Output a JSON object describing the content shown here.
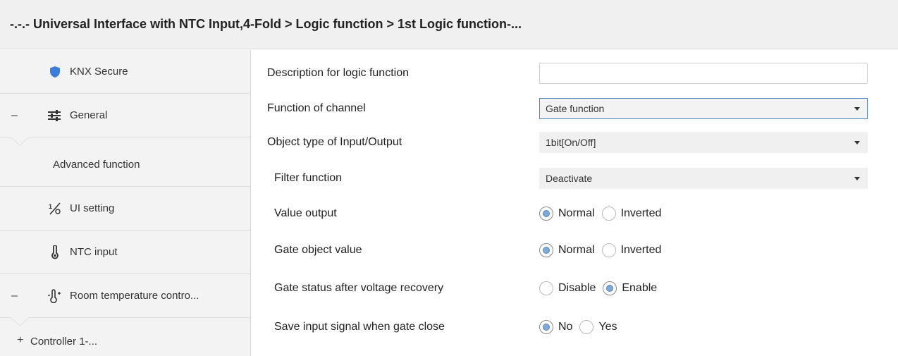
{
  "window": {
    "breadcrumb": "-.-.- Universal Interface with NTC Input,4-Fold > Logic function > 1st Logic function-..."
  },
  "sidebar": {
    "items": [
      {
        "label": "KNX Secure",
        "icon": "shield-icon",
        "toggle": ""
      },
      {
        "label": "General",
        "icon": "sliders-icon",
        "toggle": "–"
      },
      {
        "label": "Advanced function",
        "icon": "",
        "toggle": ""
      },
      {
        "label": "UI setting",
        "icon": "ui-setting-icon",
        "toggle": ""
      },
      {
        "label": "NTC input",
        "icon": "thermometer-icon",
        "toggle": ""
      },
      {
        "label": "Room temperature contro...",
        "icon": "thermometer-plus-icon",
        "toggle": "–"
      },
      {
        "label": "Controller 1-...",
        "icon": "",
        "toggle": "+"
      }
    ]
  },
  "params": {
    "description": {
      "label": "Description for logic function",
      "value": ""
    },
    "function_of_channel": {
      "label": "Function of channel",
      "value": "Gate function"
    },
    "object_type": {
      "label": "Object type of Input/Output",
      "value": "1bit[On/Off]"
    },
    "filter_function": {
      "label": "Filter function",
      "value": "Deactivate"
    },
    "value_output": {
      "label": "Value output",
      "options": [
        "Normal",
        "Inverted"
      ],
      "selected": "Normal"
    },
    "gate_object_value": {
      "label": "Gate object value",
      "options": [
        "Normal",
        "Inverted"
      ],
      "selected": "Normal"
    },
    "gate_status_recovery": {
      "label": "Gate status after voltage recovery",
      "options": [
        "Disable",
        "Enable"
      ],
      "selected": "Enable"
    },
    "save_input_signal": {
      "label": "Save input signal when gate close",
      "options": [
        "No",
        "Yes"
      ],
      "selected": "No"
    }
  },
  "colors": {
    "shield": "#3b7dd8",
    "focus_border": "#4a84c4",
    "radio_dot": "#7fa9d6"
  }
}
